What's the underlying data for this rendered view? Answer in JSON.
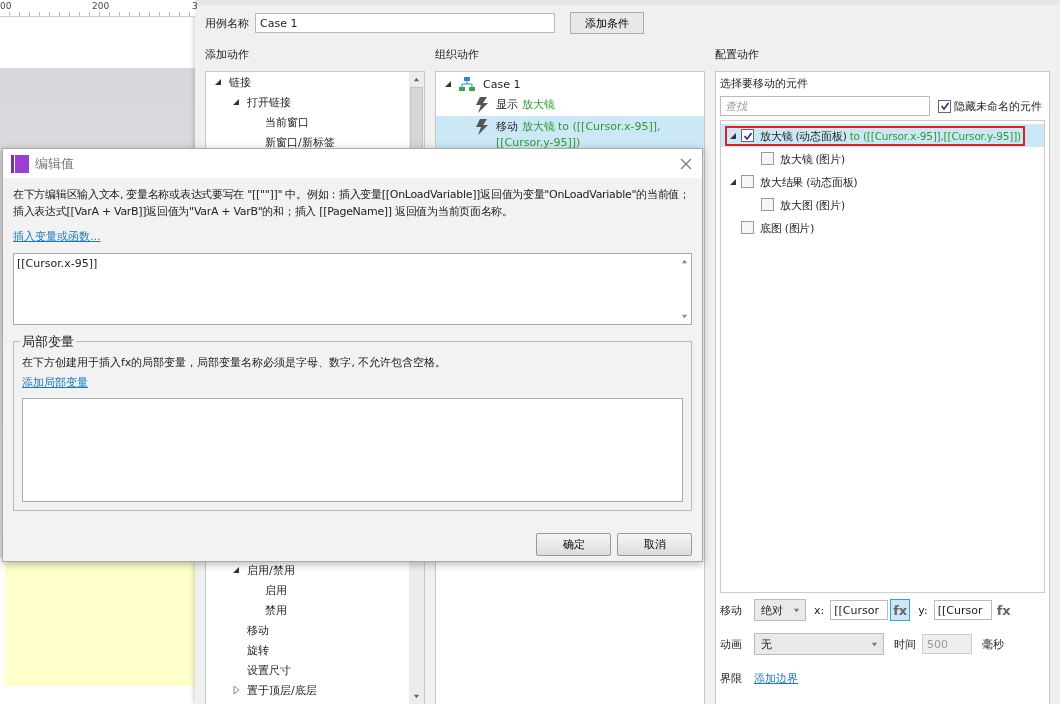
{
  "canvas": {
    "ruler_labels": [
      "00",
      "200",
      "3"
    ]
  },
  "case_name": {
    "label": "用例名称",
    "value": "Case 1"
  },
  "add_condition_button": "添加条件",
  "add_action": {
    "title": "添加动作",
    "upper_items": [
      {
        "label": "链接",
        "expanded": true,
        "children": [
          {
            "label": "打开链接",
            "expanded": true,
            "children": [
              {
                "label": "当前窗口"
              },
              {
                "label": "新窗口/新标签"
              }
            ]
          }
        ]
      }
    ],
    "lower_items": [
      {
        "label": "启用/禁用",
        "expanded": true,
        "children": [
          {
            "label": "启用"
          },
          {
            "label": "禁用"
          }
        ]
      },
      {
        "label": "移动"
      },
      {
        "label": "旋转"
      },
      {
        "label": "设置尺寸"
      },
      {
        "label": "置于顶层/底层",
        "expanded": false
      }
    ]
  },
  "organize_action": {
    "title": "组织动作",
    "cases": [
      {
        "label": "Case 1",
        "expanded": true,
        "actions": [
          {
            "verb": "显示",
            "target": "放大镜",
            "selected": false
          },
          {
            "verb": "移动",
            "target": "放大镜 to ([[Cursor.x-95]], [[Cursor.y-95]])",
            "selected": true
          }
        ]
      }
    ]
  },
  "configure_action": {
    "title": "配置动作",
    "subtitle": "选择要移动的元件",
    "search": {
      "placeholder": "查找"
    },
    "hide_unnamed": {
      "label": "隐藏未命名的元件",
      "checked": true
    },
    "widgets": [
      {
        "label": "放大镜 (动态面板)",
        "suffix": "to ([[Cursor.x-95]],[[Cursor.y-95]])",
        "checked": true,
        "selected": true,
        "highlighted": true,
        "expanded": true,
        "children": [
          {
            "label": "放大镜 (图片)",
            "checked": false,
            "selected": false,
            "highlighted": false
          }
        ]
      },
      {
        "label": "放大结果 (动态面板)",
        "checked": false,
        "selected": false,
        "highlighted": false,
        "expanded": true,
        "children": [
          {
            "label": "放大图 (图片)",
            "checked": false,
            "selected": false,
            "highlighted": false
          }
        ]
      },
      {
        "label": "底图 (图片)",
        "checked": false,
        "selected": false,
        "highlighted": false
      }
    ],
    "move": {
      "label": "移动",
      "mode": "绝对",
      "x_label": "x:",
      "x_value": "[[Cursor",
      "x_fx": "fx",
      "x_fx_selected": true,
      "y_label": "y:",
      "y_value": "[[Cursor",
      "y_fx": "fx",
      "y_fx_selected": false
    },
    "animation": {
      "label": "动画",
      "value": "无",
      "time_label": "时间",
      "time_value": "500",
      "time_disabled": true,
      "unit": "毫秒"
    },
    "bounds": {
      "label": "界限",
      "link": "添加边界"
    }
  },
  "dialog": {
    "title": "编辑值",
    "description": "在下方编辑区输入文本, 变量名称或表达式要写在 \"[[\"\"]]\" 中。例如：插入变量[[OnLoadVariable]]返回值为变量\"OnLoadVariable\"的当前值；插入表达式[[VarA + VarB]]返回值为\"VarA + VarB\"的和；插入 [[PageName]] 返回值为当前页面名称。",
    "insert_link": "插入变量或函数...",
    "value": "[[Cursor.x-95]]",
    "local_vars": {
      "legend": "局部变量",
      "description": "在下方创建用于插入fx的局部变量，局部变量名称必须是字母、数字, 不允许包含空格。",
      "add_link": "添加局部变量"
    },
    "buttons": [
      "确定",
      "取消"
    ]
  }
}
